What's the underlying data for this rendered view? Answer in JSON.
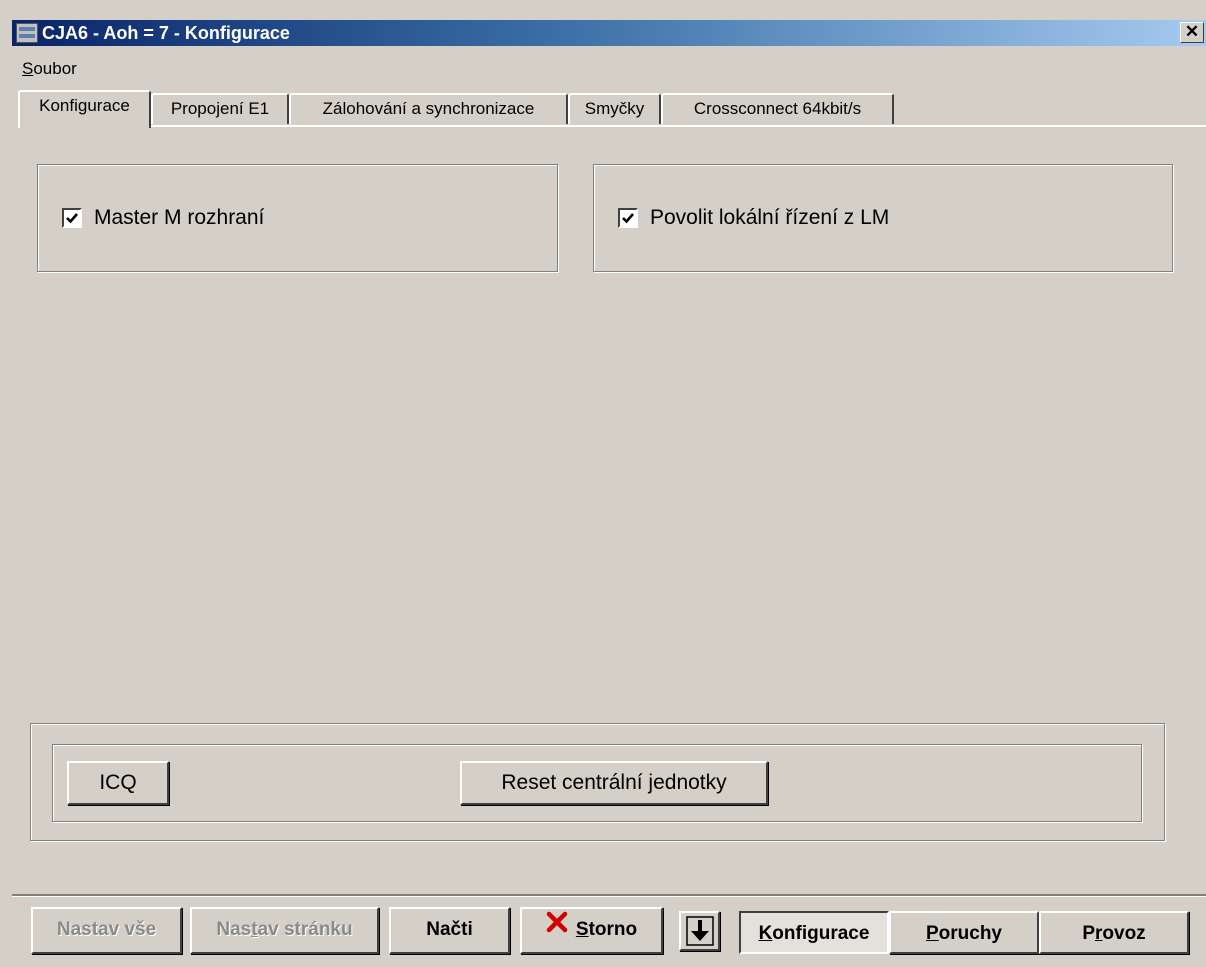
{
  "window": {
    "title": "CJA6 - Aoh = 7 - Konfigurace",
    "close_glyph": "✕"
  },
  "menu": {
    "items": [
      {
        "label": "Soubor",
        "accelerator": "S",
        "rest": "oubor"
      }
    ]
  },
  "tabs": [
    {
      "label": "Konfigurace",
      "active": true
    },
    {
      "label": "Propojení E1",
      "active": false
    },
    {
      "label": "Zálohování a synchronizace",
      "active": false
    },
    {
      "label": "Smyčky",
      "active": false
    },
    {
      "label": "Crossconnect 64kbit/s",
      "active": false
    }
  ],
  "options": {
    "master_m": {
      "label": "Master M rozhraní",
      "checked": true
    },
    "local_control": {
      "label": "Povolit lokální řízení z LM",
      "checked": true
    }
  },
  "actions": {
    "icq": "ICQ",
    "reset": "Reset centrální  jednotky"
  },
  "toolbar": {
    "set_all": "Nastav vše",
    "set_page_pre": "Nas",
    "set_page_acc": "t",
    "set_page_post": "av stránku",
    "load": "Načti",
    "cancel_acc": "S",
    "cancel_rest": "torno",
    "configuration_acc": "K",
    "configuration_rest": "onfigurace",
    "faults_acc": "P",
    "faults_rest": "oruchy",
    "operation_pre": "P",
    "operation_acc": "r",
    "operation_post": "ovoz"
  },
  "icons": {
    "app": "app-icon",
    "cancel": "red-x-icon",
    "download": "down-arrow-icon"
  },
  "colors": {
    "face": "#d4d0c8",
    "title_start": "#0a246a",
    "title_end": "#a6caf0",
    "cancel_icon": "#d40000"
  }
}
